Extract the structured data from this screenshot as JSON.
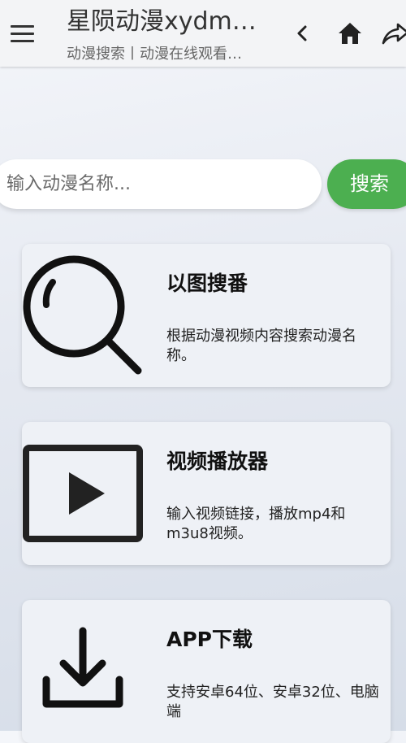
{
  "header": {
    "title": "星陨动漫xydm…",
    "subtitle": "动漫搜索丨动漫在线观看…",
    "icons": [
      "menu-icon",
      "back-icon",
      "home-icon",
      "share-icon"
    ]
  },
  "search": {
    "placeholder": "输入动漫名称...",
    "value": "",
    "button_label": "搜索",
    "button_color": "#4caf50"
  },
  "cards": [
    {
      "icon": "search-icon",
      "title": "以图搜番",
      "description": "根据动漫视频内容搜索动漫名称。"
    },
    {
      "icon": "play-icon",
      "title": "视频播放器",
      "description": "输入视频链接，播放mp4和m3u8视频。"
    },
    {
      "icon": "download-icon",
      "title": "APP下载",
      "description": "支持安卓64位、安卓32位、电脑端"
    }
  ]
}
